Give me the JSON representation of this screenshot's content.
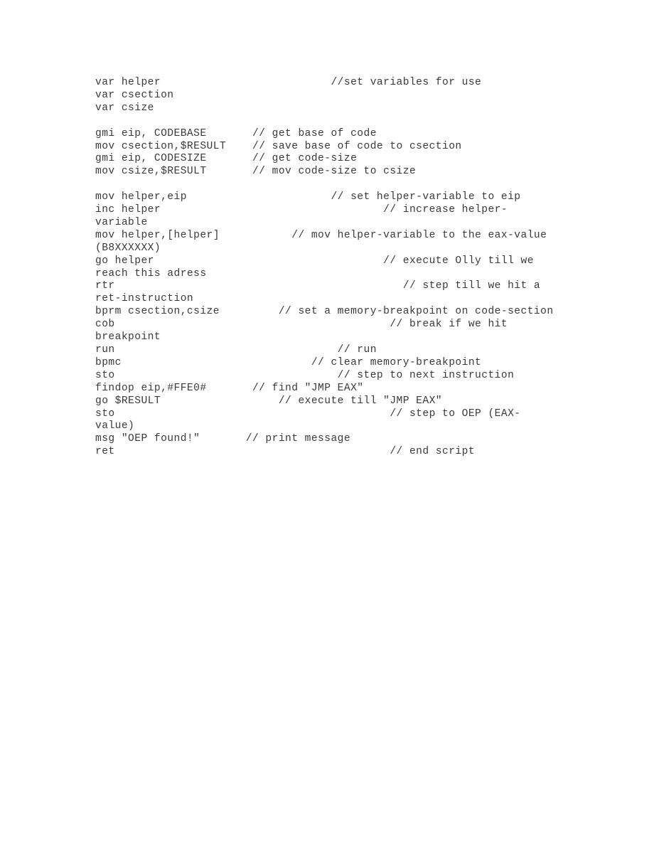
{
  "document": {
    "type": "plain-text-script-listing",
    "language": "ollydbg-script",
    "text_color": "#3a3a3a",
    "background_color": "#ffffff",
    "lines": [
      {
        "id": "line-01",
        "text": "var helper                          //set variables for use"
      },
      {
        "id": "line-02",
        "text": "var csection"
      },
      {
        "id": "line-03",
        "text": "var csize"
      },
      {
        "id": "line-04",
        "text": ""
      },
      {
        "id": "line-05",
        "text": "gmi eip, CODEBASE       // get base of code"
      },
      {
        "id": "line-06",
        "text": "mov csection,$RESULT    // save base of code to csection"
      },
      {
        "id": "line-07",
        "text": "gmi eip, CODESIZE       // get code-size"
      },
      {
        "id": "line-08",
        "text": "mov csize,$RESULT       // mov code-size to csize"
      },
      {
        "id": "line-09",
        "text": ""
      },
      {
        "id": "line-10",
        "text": "mov helper,eip                      // set helper-variable to eip"
      },
      {
        "id": "line-11",
        "text": "inc helper                                  // increase helper-variable"
      },
      {
        "id": "line-12",
        "text": "mov helper,[helper]           // mov helper-variable to the eax-value (B8XXXXXX)"
      },
      {
        "id": "line-13",
        "text": "go helper                                   // execute Olly till we reach this adress"
      },
      {
        "id": "line-14",
        "text": "rtr                                            // step till we hit a ret-instruction"
      },
      {
        "id": "line-15",
        "text": "bprm csection,csize         // set a memory-breakpoint on code-section"
      },
      {
        "id": "line-16",
        "text": "cob                                          // break if we hit breakpoint"
      },
      {
        "id": "line-17",
        "text": "run                                  // run"
      },
      {
        "id": "line-18",
        "text": "bpmc                             // clear memory-breakpoint"
      },
      {
        "id": "line-19",
        "text": "sto                                  // step to next instruction"
      },
      {
        "id": "line-20",
        "text": "findop eip,#FFE0#       // find \"JMP EAX\""
      },
      {
        "id": "line-21",
        "text": "go $RESULT                  // execute till \"JMP EAX\""
      },
      {
        "id": "line-22",
        "text": "sto                                          // step to OEP (EAX-value)"
      },
      {
        "id": "line-23",
        "text": "msg \"OEP found!\"       // print message"
      },
      {
        "id": "line-24",
        "text": "ret                                          // end script"
      }
    ]
  }
}
